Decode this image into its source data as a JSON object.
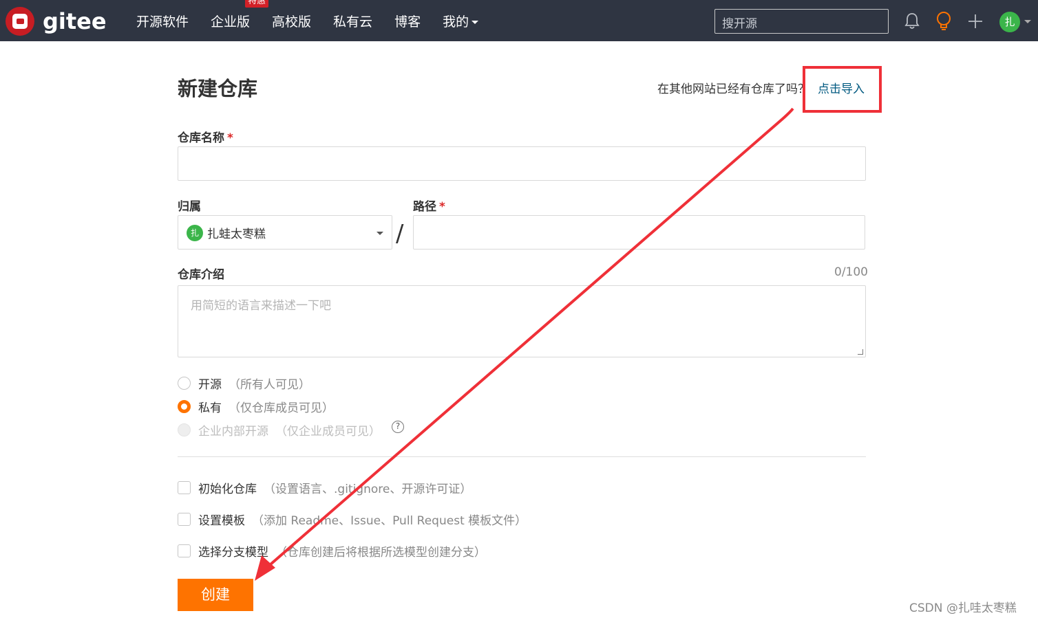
{
  "nav": {
    "logo_text": "gitee",
    "items": [
      {
        "label": "开源软件"
      },
      {
        "label": "企业版",
        "badge": "特惠"
      },
      {
        "label": "高校版"
      },
      {
        "label": "私有云"
      },
      {
        "label": "博客"
      },
      {
        "label": "我的"
      }
    ],
    "search_placeholder": "搜开源",
    "user_avatar_text": "扎",
    "icons": [
      "bell-icon",
      "bulb-icon",
      "plus-icon",
      "chevron-down-icon"
    ]
  },
  "page": {
    "title": "新建仓库",
    "import_question": "在其他网站已经有仓库了吗？",
    "import_link": "点击导入"
  },
  "form": {
    "repo_name": {
      "label": "仓库名称",
      "required": "*",
      "value": ""
    },
    "owner": {
      "label": "归属",
      "avatar_text": "扎",
      "value": "扎蛙太枣糕"
    },
    "path_separator": "/",
    "path": {
      "label": "路径",
      "required": "*",
      "value": ""
    },
    "description": {
      "label": "仓库介绍",
      "counter": "0/100",
      "placeholder": "用简短的语言来描述一下吧"
    },
    "visibility": [
      {
        "label": "开源",
        "hint": "（所有人可见）",
        "selected": false,
        "disabled": false
      },
      {
        "label": "私有",
        "hint": "（仅仓库成员可见）",
        "selected": true,
        "disabled": false
      },
      {
        "label": "企业内部开源",
        "hint": "（仅企业成员可见）",
        "selected": false,
        "disabled": true
      }
    ],
    "help_glyph": "?",
    "options": [
      {
        "label": "初始化仓库",
        "hint": "（设置语言、.gitignore、开源许可证）",
        "checked": false
      },
      {
        "label": "设置模板",
        "hint": "（添加 Readme、Issue、Pull Request 模板文件）",
        "checked": false
      },
      {
        "label": "选择分支模型",
        "hint": "（仓库创建后将根据所选模型创建分支）",
        "checked": false
      }
    ],
    "submit_label": "创建"
  },
  "colors": {
    "nav_bg": "#2f3542",
    "accent": "#fe7300",
    "annotation_red": "#ef3038",
    "link": "#005980"
  },
  "watermark": "CSDN @扎哇太枣糕"
}
